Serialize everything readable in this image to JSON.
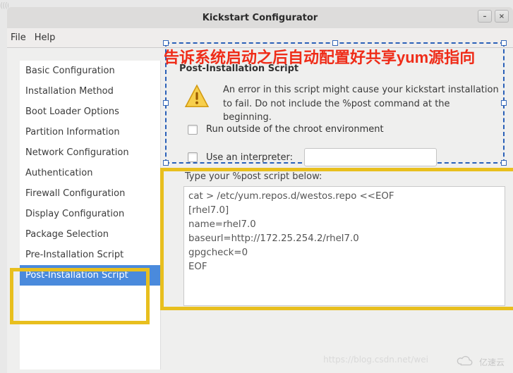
{
  "window": {
    "title": "Kickstart Configurator"
  },
  "menubar": {
    "file": "File",
    "help": "Help"
  },
  "sidebar": {
    "items": [
      "Basic Configuration",
      "Installation Method",
      "Boot Loader Options",
      "Partition Information",
      "Network Configuration",
      "Authentication",
      "Firewall Configuration",
      "Display Configuration",
      "Package Selection",
      "Pre-Installation Script",
      "Post-Installation Script"
    ],
    "selected_index": 10
  },
  "annotation": "告诉系统启动之后自动配置好共享yum源指向",
  "panel": {
    "heading": "Post-Installation Script",
    "warning": "An error in this script might cause your kickstart installation to fail. Do not include the %post command at the beginning.",
    "opt_chroot": "Run outside of the chroot environment",
    "opt_interp": "Use an interpreter:",
    "interp_value": "",
    "script_label": "Type your %post script below:",
    "script": "cat > /etc/yum.repos.d/westos.repo <<EOF\n[rhel7.0]\nname=rhel7.0\nbaseurl=http://172.25.254.2/rhel7.0\ngpgcheck=0\nEOF"
  },
  "watermark": {
    "url": "https://blog.csdn.net/wei",
    "brand": "亿速云"
  }
}
